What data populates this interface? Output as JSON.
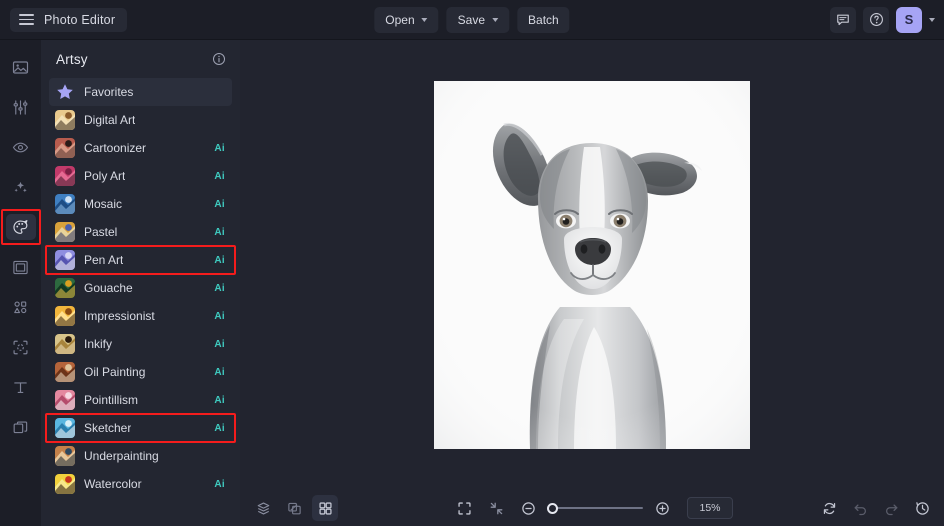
{
  "app": {
    "title": "Photo Editor",
    "menu_icon": "hamburger-icon"
  },
  "topbar": {
    "open_label": "Open",
    "save_label": "Save",
    "batch_label": "Batch",
    "feedback_icon": "chat-icon",
    "help_icon": "question-circle-icon",
    "avatar_initial": "S"
  },
  "rail": {
    "items": [
      {
        "icon": "image-icon",
        "name": "rail-item-image",
        "active": false,
        "marked": false
      },
      {
        "icon": "adjust-icon",
        "name": "rail-item-adjust",
        "active": false,
        "marked": false
      },
      {
        "icon": "eye-icon",
        "name": "rail-item-retouch",
        "active": false,
        "marked": false
      },
      {
        "icon": "sparkles-icon",
        "name": "rail-item-effects",
        "active": false,
        "marked": false
      },
      {
        "icon": "palette-icon",
        "name": "rail-item-artsy",
        "active": true,
        "marked": true
      },
      {
        "icon": "frame-icon",
        "name": "rail-item-frames",
        "active": false,
        "marked": false
      },
      {
        "icon": "shapes-icon",
        "name": "rail-item-overlays",
        "active": false,
        "marked": false
      },
      {
        "icon": "cutout-icon",
        "name": "rail-item-cutout",
        "active": false,
        "marked": false
      },
      {
        "icon": "text-icon",
        "name": "rail-item-text",
        "active": false,
        "marked": false
      },
      {
        "icon": "layers-copy-icon",
        "name": "rail-item-layers",
        "active": false,
        "marked": false
      }
    ]
  },
  "panel": {
    "title": "Artsy",
    "info_icon": "info-circle-icon",
    "items": [
      {
        "label": "Favorites",
        "ai": "",
        "favorite": true,
        "marked": false,
        "thumb": "star"
      },
      {
        "label": "Digital Art",
        "ai": "",
        "favorite": false,
        "marked": false,
        "thumb": "digital-art"
      },
      {
        "label": "Cartoonizer",
        "ai": "Ai",
        "favorite": false,
        "marked": false,
        "thumb": "cartoonizer"
      },
      {
        "label": "Poly Art",
        "ai": "Ai",
        "favorite": false,
        "marked": false,
        "thumb": "poly-art"
      },
      {
        "label": "Mosaic",
        "ai": "Ai",
        "favorite": false,
        "marked": false,
        "thumb": "mosaic"
      },
      {
        "label": "Pastel",
        "ai": "Ai",
        "favorite": false,
        "marked": false,
        "thumb": "pastel"
      },
      {
        "label": "Pen Art",
        "ai": "Ai",
        "favorite": false,
        "marked": true,
        "thumb": "pen-art"
      },
      {
        "label": "Gouache",
        "ai": "Ai",
        "favorite": false,
        "marked": false,
        "thumb": "gouache"
      },
      {
        "label": "Impressionist",
        "ai": "Ai",
        "favorite": false,
        "marked": false,
        "thumb": "impressionist"
      },
      {
        "label": "Inkify",
        "ai": "Ai",
        "favorite": false,
        "marked": false,
        "thumb": "inkify"
      },
      {
        "label": "Oil Painting",
        "ai": "Ai",
        "favorite": false,
        "marked": false,
        "thumb": "oil-painting"
      },
      {
        "label": "Pointillism",
        "ai": "Ai",
        "favorite": false,
        "marked": false,
        "thumb": "pointillism"
      },
      {
        "label": "Sketcher",
        "ai": "Ai",
        "favorite": false,
        "marked": true,
        "thumb": "sketcher"
      },
      {
        "label": "Underpainting",
        "ai": "",
        "favorite": false,
        "marked": false,
        "thumb": "underpainting"
      },
      {
        "label": "Watercolor",
        "ai": "Ai",
        "favorite": false,
        "marked": false,
        "thumb": "watercolor"
      }
    ]
  },
  "canvas": {
    "image_alt": "black-and-white-dog-portrait"
  },
  "bottombar": {
    "layers_icon": "layers-icon",
    "compare_icon": "compare-icon",
    "grid_icon": "grid-icon",
    "fit_icon": "fit-screen-icon",
    "actual_icon": "collapse-icon",
    "zoom_out_icon": "zoom-out-icon",
    "zoom_in_icon": "zoom-in-icon",
    "zoom_value": "15%",
    "reset_icon": "reset-icon",
    "undo_icon": "undo-icon",
    "redo_icon": "redo-icon",
    "history_icon": "history-icon"
  },
  "colors": {
    "accent_purple": "#a6a4f5",
    "ai_teal": "#3fcbc0",
    "marker_red": "#f51c1c",
    "panel_bg": "#232631",
    "canvas_bg": "#22242f",
    "chrome_bg": "#1c1e27"
  }
}
